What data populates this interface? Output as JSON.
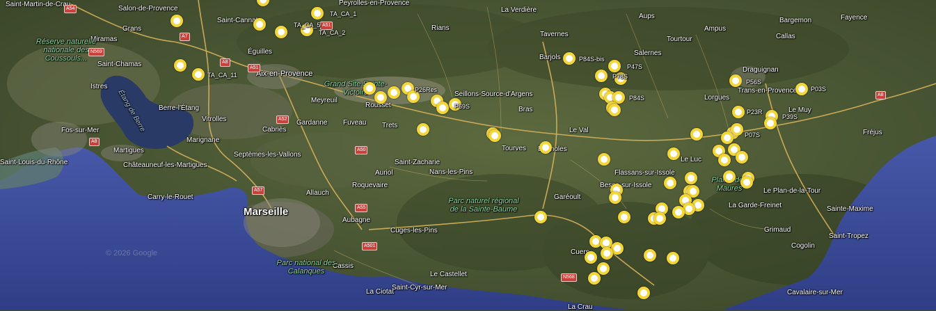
{
  "map": {
    "attribution": "© 2026 Google",
    "colors": {
      "land": "#4a5735",
      "sea": "#3a4e9c",
      "marker_ring": "#f3d63a",
      "marker_center": "#ffffff",
      "road": "#d8b35a",
      "shield": "#c9413a"
    },
    "place_labels": [
      {
        "text": "Saint-Martin-de-Crau",
        "kind": "town"
      },
      {
        "text": "Salon-de-Provence",
        "kind": "town"
      },
      {
        "text": "Grans",
        "kind": "town"
      },
      {
        "text": "Miramas",
        "kind": "town"
      },
      {
        "text": "Saint-Chamas",
        "kind": "town"
      },
      {
        "text": "Istres",
        "kind": "town"
      },
      {
        "text": "Berre-l'Étang",
        "kind": "town"
      },
      {
        "text": "Vitrolles",
        "kind": "town"
      },
      {
        "text": "Fos-sur-Mer",
        "kind": "town"
      },
      {
        "text": "Martigues",
        "kind": "town"
      },
      {
        "text": "Marignane",
        "kind": "town"
      },
      {
        "text": "Saint-Louis-du-Rhône",
        "kind": "town"
      },
      {
        "text": "Châteauneuf-les-Martigues",
        "kind": "town"
      },
      {
        "text": "Carry-le-Rouet",
        "kind": "town"
      },
      {
        "text": "Saint-Cannat",
        "kind": "town"
      },
      {
        "text": "Éguilles",
        "kind": "town"
      },
      {
        "text": "Aix-en-Provence",
        "kind": "city"
      },
      {
        "text": "Meyreuil",
        "kind": "town"
      },
      {
        "text": "Gardanne",
        "kind": "town"
      },
      {
        "text": "Cabriès",
        "kind": "town"
      },
      {
        "text": "Septèmes-les-Vallons",
        "kind": "town"
      },
      {
        "text": "Allauch",
        "kind": "town"
      },
      {
        "text": "Marseille",
        "kind": "major"
      },
      {
        "text": "Aubagne",
        "kind": "town"
      },
      {
        "text": "Cassis",
        "kind": "town"
      },
      {
        "text": "La Ciotat",
        "kind": "town"
      },
      {
        "text": "Saint-Cyr-sur-Mer",
        "kind": "town"
      },
      {
        "text": "Le Castellet",
        "kind": "town"
      },
      {
        "text": "Cuges-les-Pins",
        "kind": "town"
      },
      {
        "text": "Roquevaire",
        "kind": "town"
      },
      {
        "text": "Auriol",
        "kind": "town"
      },
      {
        "text": "Saint-Zacharie",
        "kind": "town"
      },
      {
        "text": "Nans-les-Pins",
        "kind": "town"
      },
      {
        "text": "Fuveau",
        "kind": "town"
      },
      {
        "text": "Trets",
        "kind": "town"
      },
      {
        "text": "Rousset",
        "kind": "town"
      },
      {
        "text": "Peyrolles-en-Provence",
        "kind": "town"
      },
      {
        "text": "Rians",
        "kind": "town"
      },
      {
        "text": "La Verdière",
        "kind": "town"
      },
      {
        "text": "Seillons-Source-d'Argens",
        "kind": "town"
      },
      {
        "text": "Bras",
        "kind": "town"
      },
      {
        "text": "Tourves",
        "kind": "town"
      },
      {
        "text": "Brignoles",
        "kind": "town"
      },
      {
        "text": "Le Val",
        "kind": "town"
      },
      {
        "text": "Tavernes",
        "kind": "town"
      },
      {
        "text": "Barjols",
        "kind": "town"
      },
      {
        "text": "Aups",
        "kind": "town"
      },
      {
        "text": "Salernes",
        "kind": "town"
      },
      {
        "text": "Tourtour",
        "kind": "town"
      },
      {
        "text": "Ampus",
        "kind": "town"
      },
      {
        "text": "Bargemon",
        "kind": "town"
      },
      {
        "text": "Callas",
        "kind": "town"
      },
      {
        "text": "Fayence",
        "kind": "town"
      },
      {
        "text": "Draguignan",
        "kind": "town"
      },
      {
        "text": "Trans-en-Provence",
        "kind": "town"
      },
      {
        "text": "Lorgues",
        "kind": "town"
      },
      {
        "text": "Le Muy",
        "kind": "town"
      },
      {
        "text": "Fréjus",
        "kind": "town"
      },
      {
        "text": "Flassans-sur-Issole",
        "kind": "town"
      },
      {
        "text": "Besse-sur-Issole",
        "kind": "town"
      },
      {
        "text": "Le Luc",
        "kind": "town"
      },
      {
        "text": "Garéoult",
        "kind": "town"
      },
      {
        "text": "La Garde-Freinet",
        "kind": "town"
      },
      {
        "text": "Le Plan-de-la-Tour",
        "kind": "town"
      },
      {
        "text": "Sainte-Maxime",
        "kind": "town"
      },
      {
        "text": "Grimaud",
        "kind": "town"
      },
      {
        "text": "Saint-Tropez",
        "kind": "town"
      },
      {
        "text": "Cogolin",
        "kind": "town"
      },
      {
        "text": "Cavalaire-sur-Mer",
        "kind": "town"
      },
      {
        "text": "La Crau",
        "kind": "town"
      },
      {
        "text": "Cuers",
        "kind": "town"
      }
    ],
    "nature_labels": [
      {
        "text": "Réserve naturelle nationale des Coussouls...",
        "kind": "park"
      },
      {
        "text": "Grand Site Sainte-Victoire",
        "kind": "park"
      },
      {
        "text": "Parc naturel régional de la Sainte-Baume",
        "kind": "park"
      },
      {
        "text": "Parc national des Calanques",
        "kind": "park"
      },
      {
        "text": "Plaine des Maures",
        "kind": "park"
      },
      {
        "text": "Étang de Berre",
        "kind": "water"
      }
    ],
    "road_shields": [
      "A54",
      "A7",
      "N569",
      "A8",
      "A51",
      "A52",
      "A50",
      "A501",
      "A55",
      "A57",
      "N568",
      "A8",
      "A51",
      "A8"
    ],
    "site_labels": [
      "TA_CA_1",
      "TA_CA_5",
      "TA_CA_2",
      "TA_CA_11",
      "P26Res",
      "P69S",
      "P84S-bis",
      "P47S",
      "P78S",
      "P84S",
      "P56S",
      "P03S",
      "P23R",
      "P39S",
      "P07S"
    ],
    "marker_count": 72
  }
}
